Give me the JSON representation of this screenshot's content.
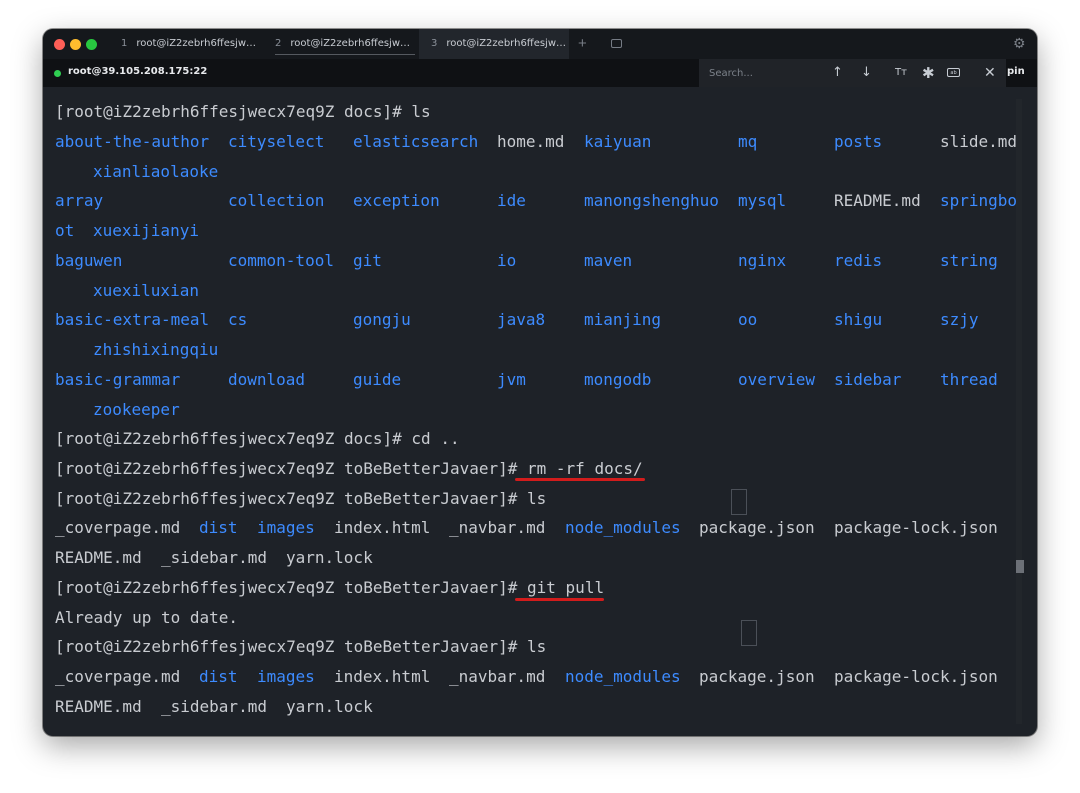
{
  "tabs": [
    {
      "number": "1",
      "title": "root@iZ2zebrh6ffesjw…"
    },
    {
      "number": "2",
      "title": "root@iZ2zebrh6ffesjw…"
    },
    {
      "number": "3",
      "title": "root@iZ2zebrh6ffesjw…"
    }
  ],
  "tab_add": "+",
  "host": "root@39.105.208.175:22",
  "search": {
    "placeholder": "Search...",
    "up": "↑",
    "down": "↓",
    "font_size": "Tт",
    "regex": "✱",
    "match_whole": "ab",
    "close": "✕"
  },
  "pin_label": "pin",
  "terminal": {
    "prompt_docs": "[root@iZ2zebrh6ffesjwecx7eq9Z docs]# ",
    "prompt_proj": "[root@iZ2zebrh6ffesjwecx7eq9Z toBeBetterJavaer]# ",
    "cmd_ls": "ls",
    "cmd_cd": "cd ..",
    "cmd_rm": "rm -rf docs/",
    "cmd_git": "git pull",
    "git_output": "Already up to date.",
    "docs_listing": {
      "row1": [
        "about-the-author",
        "cityselect",
        "elasticsearch",
        "home.md",
        "kaiyuan",
        "mq",
        "posts",
        "slide.md"
      ],
      "row1_wrap": "xianliaolaoke",
      "row2": [
        "array",
        "collection",
        "exception",
        "ide",
        "manongshenghuo",
        "mysql",
        "README.md",
        "springbo"
      ],
      "row2_wrap": [
        "ot",
        "xuexijianyi"
      ],
      "row3": [
        "baguwen",
        "common-tool",
        "git",
        "io",
        "maven",
        "nginx",
        "redis",
        "string"
      ],
      "row3_wrap": "xuexiluxian",
      "row4": [
        "basic-extra-meal",
        "cs",
        "gongju",
        "java8",
        "mianjing",
        "oo",
        "shigu",
        "szjy"
      ],
      "row4_wrap": "zhishixingqiu",
      "row5": [
        "basic-grammar",
        "download",
        "guide",
        "jvm",
        "mongodb",
        "overview",
        "sidebar",
        "thread"
      ],
      "row5_wrap": "zookeeper"
    },
    "proj_listing": {
      "row1": [
        "_coverpage.md",
        "dist",
        "images",
        "index.html",
        "_navbar.md",
        "node_modules",
        "package.json",
        "package-lock.json"
      ],
      "row2": [
        "README.md",
        "_sidebar.md",
        "yarn.lock"
      ]
    }
  },
  "colors": {
    "background": "#1e2228",
    "text": "#c9ccd1",
    "directory": "#3d8bff",
    "annotation": "#d21c1c",
    "status_dot": "#2fcf52"
  },
  "icons": [
    "gear-icon",
    "arrow-up-icon",
    "arrow-down-icon",
    "font-size-icon",
    "regex-icon",
    "whole-word-icon",
    "close-icon",
    "tab-overview-icon"
  ]
}
